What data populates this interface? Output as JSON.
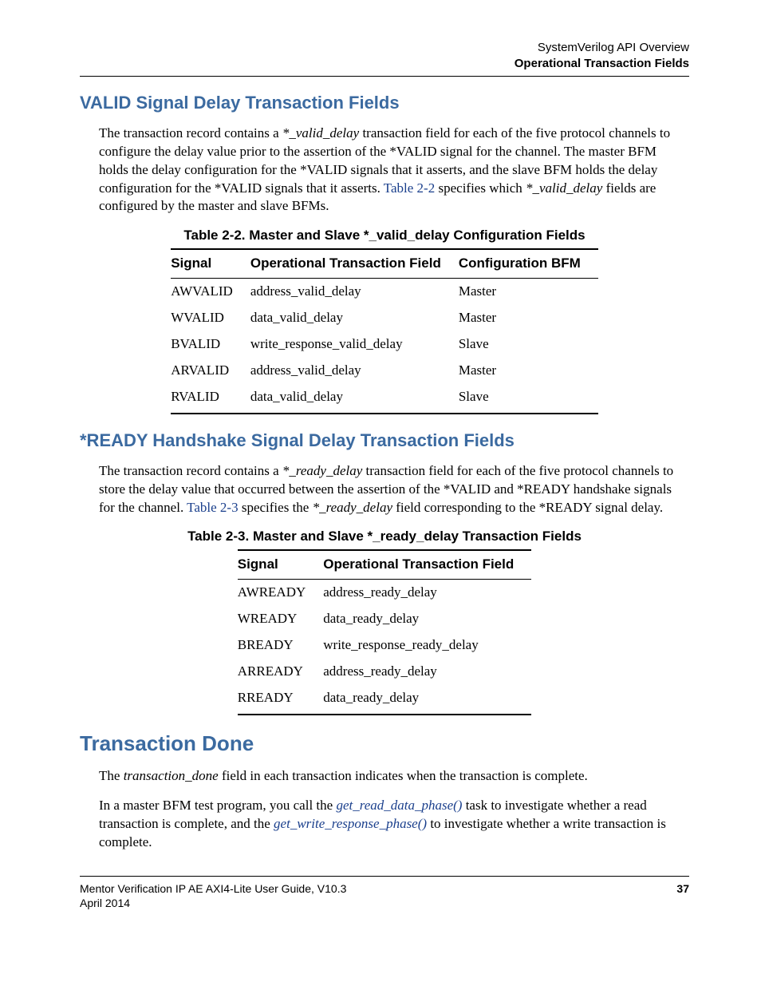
{
  "header": {
    "line1": "SystemVerilog API Overview",
    "line2": "Operational Transaction Fields"
  },
  "sec1": {
    "heading": "VALID Signal Delay Transaction Fields",
    "p1a": "The transaction record contains a ",
    "p1b": "*_valid_delay",
    "p1c": " transaction field for each of the five protocol channels to configure the delay value prior to the assertion of the *VALID signal for the channel. The master BFM holds the delay configuration for the *VALID signals that it asserts, and the slave BFM holds the delay configuration for the *VALID signals that it asserts. ",
    "p1d": "Table 2-2",
    "p1e": " specifies which ",
    "p1f": "*_valid_delay",
    "p1g": " fields are configured by the master and slave BFMs.",
    "table_caption": "Table 2-2. Master and Slave *_valid_delay Configuration Fields",
    "th1": "Signal",
    "th2": "Operational Transaction Field",
    "th3": "Configuration BFM",
    "rows": [
      {
        "c1": "AWVALID",
        "c2": "address_valid_delay",
        "c3": "Master"
      },
      {
        "c1": "WVALID",
        "c2": "data_valid_delay",
        "c3": "Master"
      },
      {
        "c1": "BVALID",
        "c2": "write_response_valid_delay",
        "c3": "Slave"
      },
      {
        "c1": "ARVALID",
        "c2": "address_valid_delay",
        "c3": "Master"
      },
      {
        "c1": "RVALID",
        "c2": "data_valid_delay",
        "c3": "Slave"
      }
    ]
  },
  "sec2": {
    "heading": "*READY Handshake Signal Delay Transaction Fields",
    "p1a": "The transaction record contains a ",
    "p1b": "*_ready_delay",
    "p1c": " transaction field for each of the five protocol channels to store the delay value that occurred between the assertion of the *VALID and *READY handshake signals for the channel. ",
    "p1d": "Table 2-3",
    "p1e": " specifies the ",
    "p1f": "*_ready_delay",
    "p1g": " field corresponding to the *READY signal delay.",
    "table_caption": "Table 2-3. Master and Slave *_ready_delay Transaction Fields",
    "th1": "Signal",
    "th2": "Operational Transaction Field",
    "rows": [
      {
        "c1": "AWREADY",
        "c2": "address_ready_delay"
      },
      {
        "c1": "WREADY",
        "c2": "data_ready_delay"
      },
      {
        "c1": "BREADY",
        "c2": "write_response_ready_delay"
      },
      {
        "c1": "ARREADY",
        "c2": "address_ready_delay"
      },
      {
        "c1": "RREADY",
        "c2": "data_ready_delay"
      }
    ]
  },
  "sec3": {
    "heading": "Transaction Done",
    "p1a": "The ",
    "p1b": "transaction_done",
    "p1c": " field in each transaction indicates when the transaction is complete.",
    "p2a": "In a master BFM test program, you call the ",
    "p2b": "get_read_data_phase()",
    "p2c": " task to investigate whether a read transaction is complete, and the ",
    "p2d": "get_write_response_phase()",
    "p2e": " to investigate whether a write transaction is complete."
  },
  "footer": {
    "left1": "Mentor Verification IP AE AXI4-Lite User Guide, V10.3",
    "left2": "April 2014",
    "right": "37"
  }
}
